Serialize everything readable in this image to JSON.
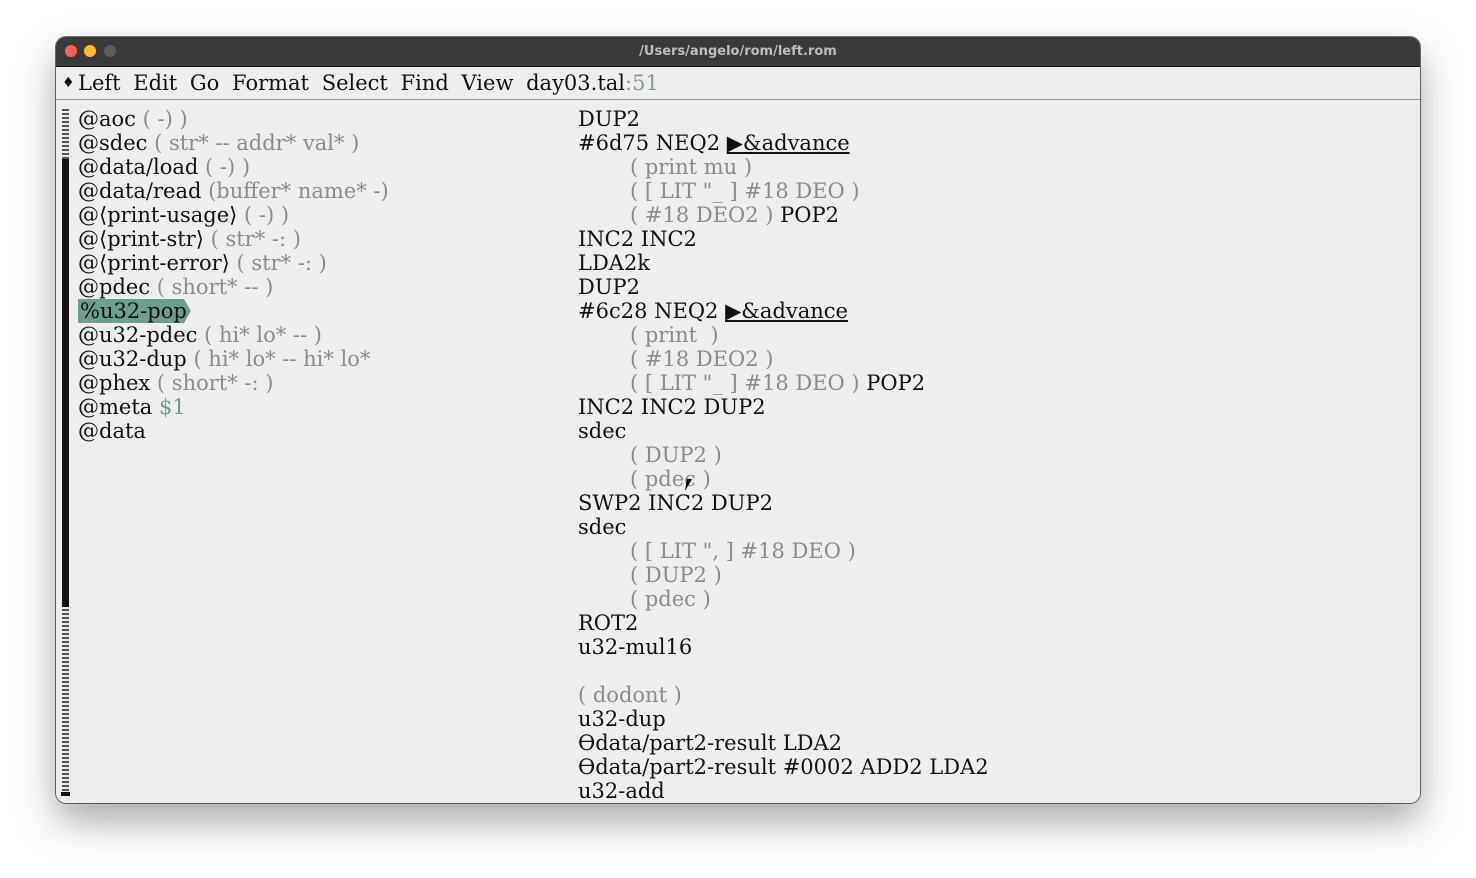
{
  "window": {
    "title": "/Users/angelo/rom/left.rom"
  },
  "menubar": {
    "diamond": "♦",
    "items": [
      "Left",
      "Edit",
      "Go",
      "Format",
      "Select",
      "Find",
      "View"
    ],
    "filename": "day03.tal",
    "line": ":51"
  },
  "symbols": [
    {
      "name": "@aoc",
      "comment": " ( -) )"
    },
    {
      "name": "@sdec",
      "comment": " ( str* -- addr* val* )"
    },
    {
      "name": "@data/load",
      "comment": " ( -) )"
    },
    {
      "name": "@data/read",
      "comment": " (buffer* name* -)"
    },
    {
      "name": "@⟨print-usage⟩",
      "comment": " ( -) )"
    },
    {
      "name": "@⟨print-str⟩",
      "comment": " ( str* -: )"
    },
    {
      "name": "@⟨print-error⟩",
      "comment": " ( str* -: )"
    },
    {
      "name": "@pdec",
      "comment": " ( short* -- )"
    },
    {
      "name": "%u32-pop",
      "comment": "",
      "highlighted": true
    },
    {
      "name": "@u32-pdec",
      "comment": " ( hi* lo* -- )"
    },
    {
      "name": "@u32-dup",
      "comment": " ( hi* lo* -- hi* lo*"
    },
    {
      "name": "@phex",
      "comment": " ( short* -: )"
    },
    {
      "name": "@meta",
      "comment": " $1",
      "green": true
    },
    {
      "name": "@data",
      "comment": ""
    }
  ],
  "code": {
    "l1": "DUP2",
    "l2a": "#6d75 NEQ2 ",
    "l2b": "▶&advance",
    "l3": "( print mu )",
    "l4": "( [ LIT \"_ ] #18 DEO )",
    "l5a": "( #18 DEO2 )",
    "l5b": " POP2",
    "l6": "INC2 INC2",
    "l7": "LDA2k",
    "l8": "DUP2",
    "l9a": "#6c28 NEQ2 ",
    "l9b": "▶&advance",
    "l10": "( print  )",
    "l11": "( #18 DEO2 )",
    "l12a": "( [ LIT \"_ ] #18 DEO )",
    "l12b": " POP2",
    "l13": "INC2 INC2 DUP2",
    "l14": "sdec",
    "l15": "( DUP2 )",
    "l16": "( pdec )",
    "l17": "SWP2 INC2 DUP2",
    "l18": "sdec",
    "l19": "( [ LIT \", ] #18 DEO )",
    "l20": "( DUP2 )",
    "l21": "( pdec )",
    "l22": "ROT2",
    "l23": "u32-mul16",
    "l24": "",
    "l25": "( dodont )",
    "l26": "u32-dup",
    "l27": "ϴdata/part2-result LDA2",
    "l28": "ϴdata/part2-result #0002 ADD2 LDA2",
    "l29": "u32-add"
  }
}
